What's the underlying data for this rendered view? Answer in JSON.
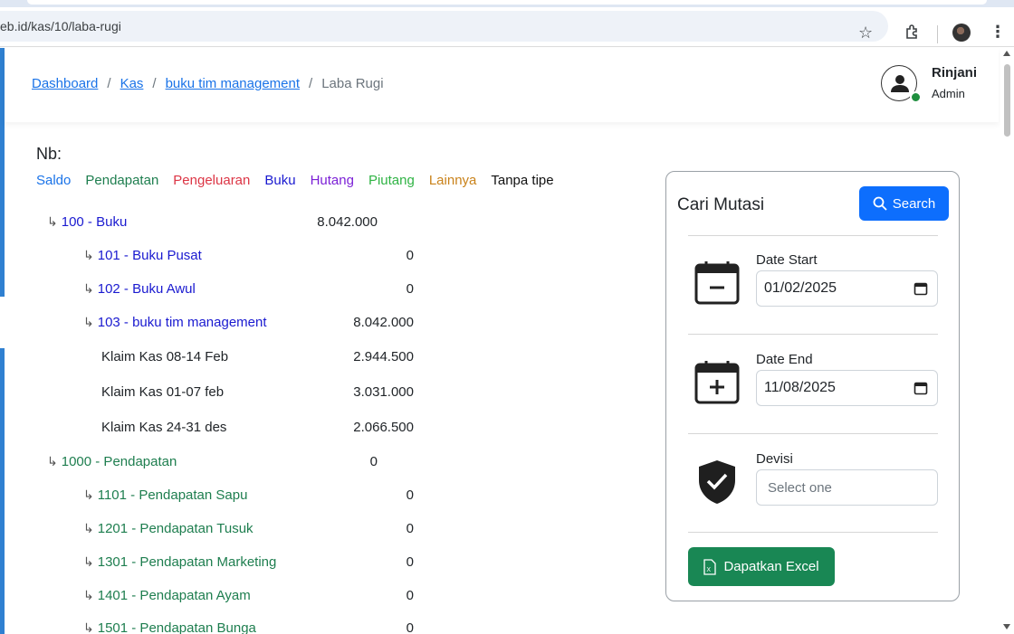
{
  "browser": {
    "url": "eb.id/kas/10/laba-rugi"
  },
  "breadcrumb": {
    "items": [
      "Dashboard",
      "Kas",
      "buku tim management"
    ],
    "current": "Laba Rugi",
    "separator": "/"
  },
  "user": {
    "name": "Rinjani",
    "role": "Admin"
  },
  "nb": {
    "title": "Nb:",
    "legend": [
      {
        "label": "Saldo",
        "color": "#1a73e8"
      },
      {
        "label": "Pendapatan",
        "color": "#1e7e4f"
      },
      {
        "label": "Pengeluaran",
        "color": "#dc3545"
      },
      {
        "label": "Buku",
        "color": "#1a1ad0"
      },
      {
        "label": "Hutang",
        "color": "#7b1fd6"
      },
      {
        "label": "Piutang",
        "color": "#2fb344"
      },
      {
        "label": "Lainnya",
        "color": "#c9821a"
      },
      {
        "label": "Tanpa tipe",
        "color": "#111111"
      }
    ]
  },
  "accounts": {
    "a100": {
      "label": "100 - Buku",
      "value": "8.042.000"
    },
    "a101": {
      "label": "101 - Buku Pusat",
      "value": "0"
    },
    "a102": {
      "label": "102 - Buku Awul",
      "value": "0"
    },
    "a103": {
      "label": "103 - buku tim management",
      "value": "8.042.000"
    },
    "k1": {
      "label": "Klaim Kas 08-14 Feb",
      "value": "2.944.500"
    },
    "k2": {
      "label": "Klaim Kas 01-07 feb",
      "value": "3.031.000"
    },
    "k3": {
      "label": "Klaim Kas 24-31 des",
      "value": "2.066.500"
    },
    "a1000": {
      "label": "1000 - Pendapatan",
      "value": "0"
    },
    "a1101": {
      "label": "1101 - Pendapatan Sapu",
      "value": "0"
    },
    "a1201": {
      "label": "1201 - Pendapatan Tusuk",
      "value": "0"
    },
    "a1301": {
      "label": "1301 - Pendapatan Marketing",
      "value": "0"
    },
    "a1401": {
      "label": "1401 - Pendapatan Ayam",
      "value": "0"
    },
    "a1501": {
      "label": "1501 - Pendapatan Bunga",
      "value": "0"
    }
  },
  "search_panel": {
    "title": "Cari Mutasi",
    "search_label": "Search",
    "date_start_label": "Date Start",
    "date_start_value": "01/02/2025",
    "date_end_label": "Date End",
    "date_end_value": "11/08/2025",
    "devisi_label": "Devisi",
    "devisi_placeholder": "Select one",
    "excel_label": "Dapatkan Excel"
  }
}
